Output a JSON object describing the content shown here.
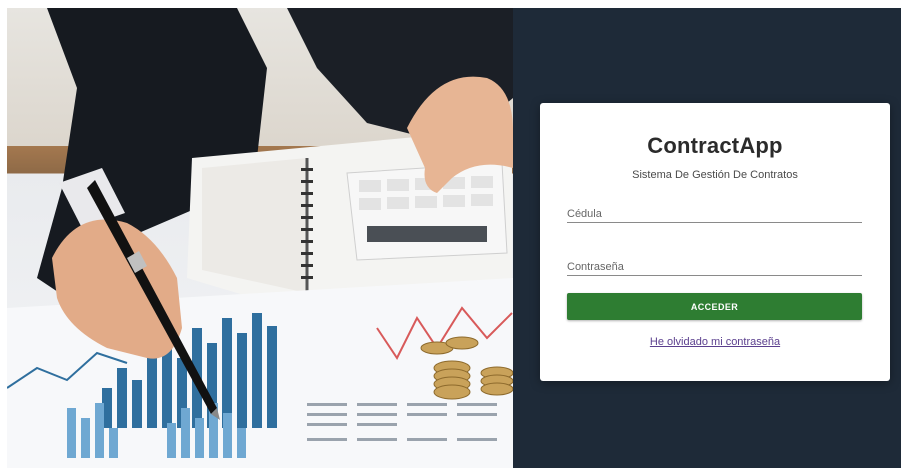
{
  "app": {
    "title": "ContractApp",
    "subtitle": "Sistema De Gestión De Contratos"
  },
  "form": {
    "id_placeholder": "Cédula",
    "id_value": "",
    "password_placeholder": "Contraseña",
    "password_value": "",
    "submit_label": "ACCEDER",
    "forgot_link": "He olvidado mi contraseña"
  },
  "hero": {
    "image": "businessperson-with-pen-calculator-coins-charts-photo"
  },
  "colors": {
    "panel_background": "#1e2a38",
    "button": "#2e7d32",
    "link": "#5b3f8e",
    "card": "#ffffff"
  }
}
